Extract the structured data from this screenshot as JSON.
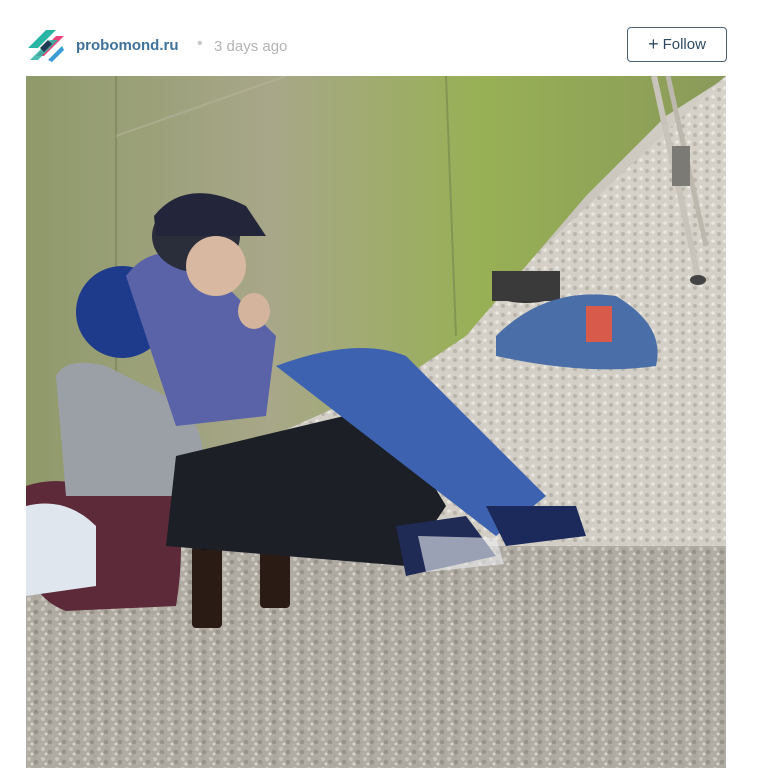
{
  "post": {
    "username": "probomond.ru",
    "separator": "•",
    "timestamp": "3 days ago",
    "follow_label": "Follow",
    "follow_icon": "plus-icon",
    "avatar_icon": "brand-logo-icon"
  },
  "colors": {
    "username": "#3f729b",
    "timestamp": "#b3b3b3",
    "button_border": "#4a6174",
    "logo_teal": "#2bb5a5",
    "logo_pink": "#e8457a"
  }
}
